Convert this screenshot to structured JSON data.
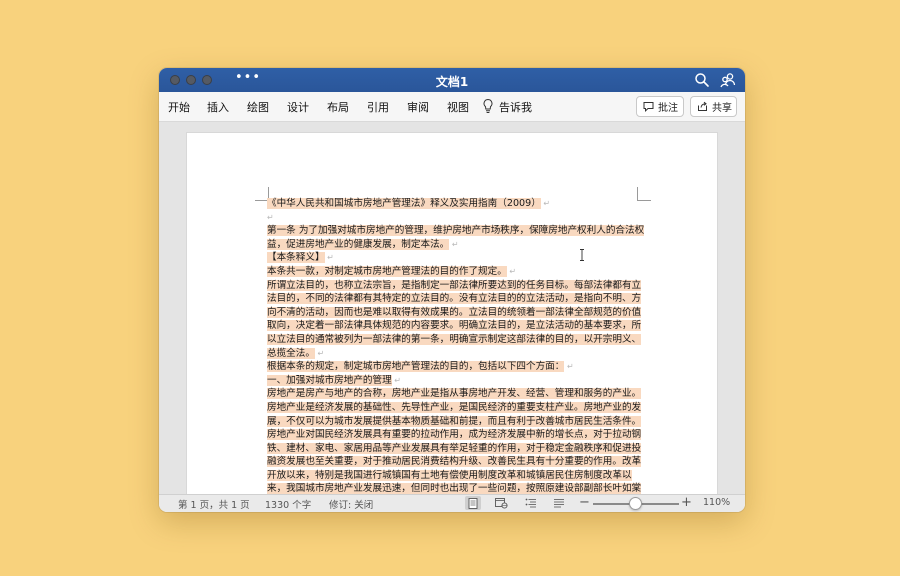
{
  "window": {
    "title": "文档1",
    "more_icon": "ellipsis-icon",
    "search_icon": "search-icon",
    "account_icon": "people-icon"
  },
  "ribbon": {
    "tabs": [
      "开始",
      "插入",
      "绘图",
      "设计",
      "布局",
      "引用",
      "审阅",
      "视图"
    ],
    "tell_me": {
      "icon": "lightbulb-icon",
      "label": "告诉我"
    },
    "comment_button": {
      "icon": "comment-icon",
      "label": "批注"
    },
    "share_button": {
      "icon": "share-icon",
      "label": "共享"
    }
  },
  "document": {
    "paragraphs": [
      "《中华人民共和国城市房地产管理法》释义及实用指南（2009）",
      "",
      "第一条   为了加强对城市房地产的管理，维护房地产市场秩序，保障房地产权利人的合法权益，促进房地产业的健康发展，制定本法。",
      "【本条释义】",
      "本条共一款，对制定城市房地产管理法的目的作了规定。",
      "所谓立法目的，也称立法宗旨，是指制定一部法律所要达到的任务目标。每部法律都有立法目的，不同的法律都有其特定的立法目的。没有立法目的的立法活动，是指向不明、方向不清的活动，因而也是难以取得有效成果的。立法目的统领着一部法律全部规范的价值取向，决定着一部法律具体规范的内容要求。明确立法目的，是立法活动的基本要求，所以立法目的通常被列为一部法律的第一条，明确宣示制定这部法律的目的，以开宗明义、总揽全法。",
      "根据本条的规定，制定城市房地产管理法的目的，包括以下四个方面：",
      "一、加强对城市房地产的管理",
      "房地产是房产与地产的合称，房地产业是指从事房地产开发、经营、管理和服务的产业。房地产业是经济发展的基础性、先导性产业，是国民经济的重要支柱产业。房地产业的发展，不仅可以为城市发展提供基本物质基础和前提，而且有利于改善城市居民生活条件。房地产业对国民经济发展具有重要的拉动作用，成为经济发展中新的增长点，对于拉动钢铁、建材、家电、家居用品等产业发展具有举足轻重的作用，对于稳定金融秩序和促进投融资发展也至关重要，对于推动居民消费结构升级、改善民生具有十分重要的作用。改革开放以来，特别是我国进行城镇国有土地有偿使用制度改革和城镇居民住房制度改革以来，我国城市房地产业发展迅速，但同时也出现了一些问题，按照原建设部副部长叶如棠在八届全国人大常委会第七次会议上所作的《关于〈中华人民共和国城市房地产管理法（草案）〉的说明》，这些"
    ]
  },
  "status": {
    "page": "第 1 页，共 1 页",
    "words": "1330 个字",
    "track_changes": "修订: 关闭",
    "zoom_minus": "−",
    "zoom_plus": "+",
    "zoom": "110%",
    "zoom_level": 1.1
  }
}
